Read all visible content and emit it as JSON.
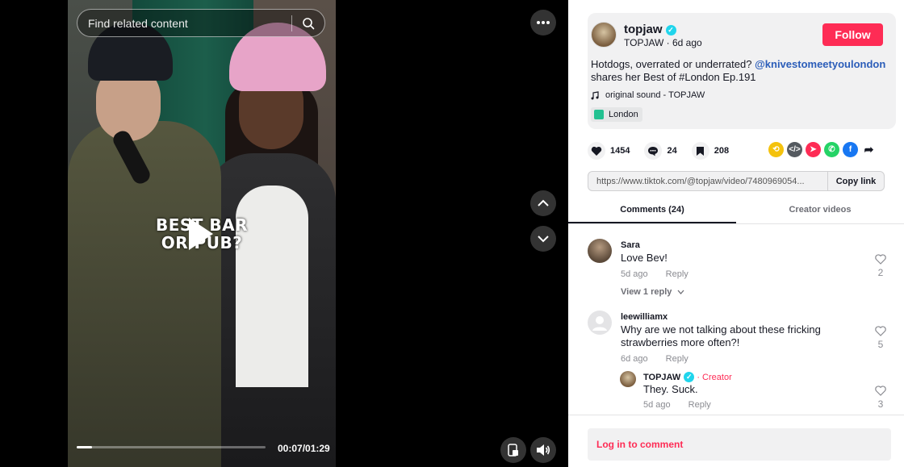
{
  "search": {
    "placeholder": "Find related content"
  },
  "player": {
    "caption_line1": "BEST BAR",
    "caption_line2": "OR PUB?",
    "time": "00:07/01:29",
    "progress": 0.08
  },
  "author": {
    "handle": "topjaw",
    "name_sub": "TOPJAW · 6d ago",
    "follow_label": "Follow"
  },
  "post": {
    "desc_prefix": "Hotdogs, overrated or underrated?",
    "mention": "@knivestomeetyoulondon",
    "desc_suffix": "shares her Best of #London Ep.191",
    "sound": "original sound - TOPJAW",
    "location": "London"
  },
  "stats": {
    "likes": "1454",
    "comments": "24",
    "saves": "208"
  },
  "share": {
    "link": "https://www.tiktok.com/@topjaw/video/7480969054...",
    "copy_label": "Copy link"
  },
  "tabs": {
    "comments": "Comments (24)",
    "creator_videos": "Creator videos"
  },
  "comments": [
    {
      "user": "Sara",
      "text": "Love Bev!",
      "time": "5d ago",
      "reply": "Reply",
      "likes": "2",
      "view_replies": "View 1 reply"
    },
    {
      "user": "leewilliamx",
      "text": "Why are we not talking about these fricking strawberries more often?!",
      "time": "6d ago",
      "reply": "Reply",
      "likes": "5"
    }
  ],
  "reply": {
    "user": "TOPJAW",
    "creator_label": "Creator",
    "text": "They. Suck.",
    "time": "5d ago",
    "reply": "Reply",
    "likes": "3"
  },
  "login": {
    "label": "Log in to comment"
  },
  "colors": {
    "accent": "#fe2c55",
    "mention": "#2b5db9",
    "verified": "#20d5ec"
  }
}
